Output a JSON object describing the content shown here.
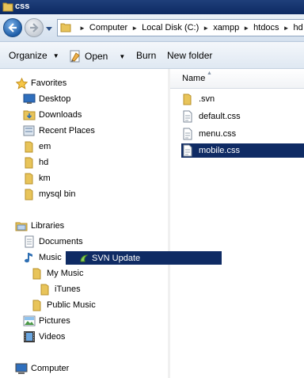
{
  "window": {
    "title": "css"
  },
  "address": {
    "crumbs": [
      "Computer",
      "Local Disk (C:)",
      "xampp",
      "htdocs",
      "hd"
    ]
  },
  "toolbar": {
    "organize": "Organize",
    "open": "Open",
    "burn": "Burn",
    "new_folder": "New folder"
  },
  "nav": {
    "favorites": "Favorites",
    "desktop": "Desktop",
    "downloads": "Downloads",
    "recent": "Recent Places",
    "em": "em",
    "hd": "hd",
    "km": "km",
    "mysql": "mysql bin",
    "libraries": "Libraries",
    "documents": "Documents",
    "music": "Music",
    "my_music": "My Music",
    "itunes": "iTunes",
    "public_music": "Public Music",
    "pictures": "Pictures",
    "videos": "Videos",
    "computer": "Computer"
  },
  "content": {
    "column_name": "Name",
    "files": [
      {
        "name": ".svn",
        "icon": "folder-icon"
      },
      {
        "name": "default.css",
        "icon": "css-file-icon"
      },
      {
        "name": "menu.css",
        "icon": "css-file-icon"
      },
      {
        "name": "mobile.css",
        "icon": "css-file-icon",
        "selected": true
      }
    ]
  },
  "context": {
    "svn_update": "SVN Update"
  },
  "colors": {
    "titlebar": "#0c2a63",
    "selection": "#0f2b64",
    "folder": "#e8c45a"
  }
}
